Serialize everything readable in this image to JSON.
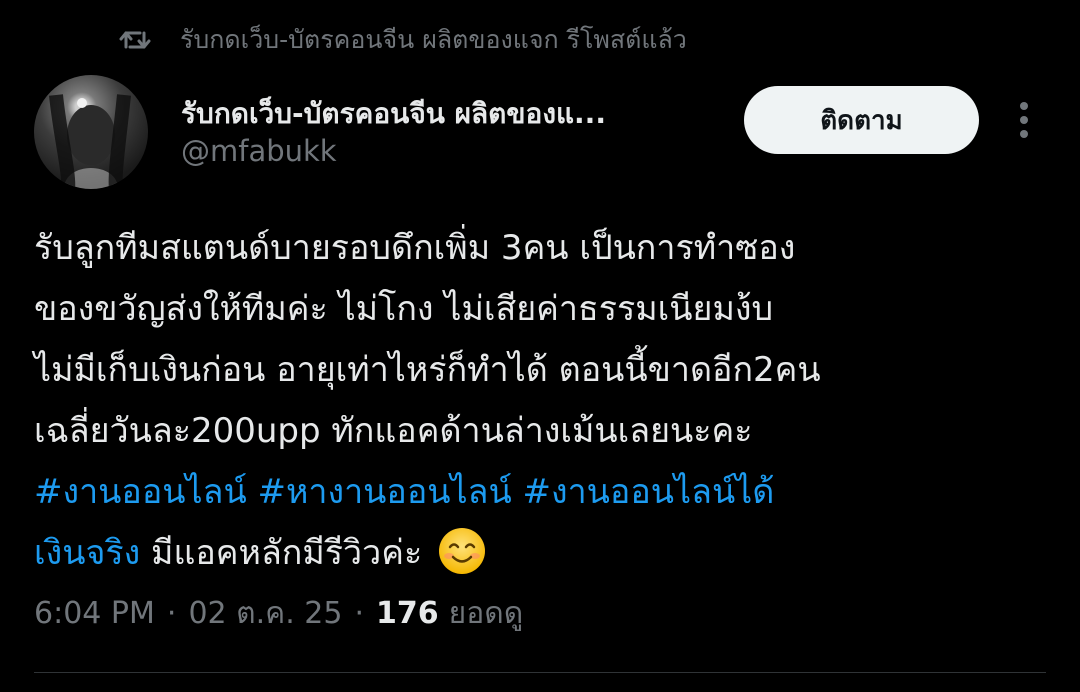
{
  "repost": {
    "text": "รับกดเว็บ-บัตรคอนจีน ผลิตของแจก รีโพสต์แล้ว",
    "icon": "repost-icon"
  },
  "author": {
    "display_name": "รับกดเว็บ-บัตรคอนจีน ผลิตของแ...",
    "handle": "@mfabukk"
  },
  "follow_label": "ติดตาม",
  "tweet": {
    "line1": "รับลูกทีมสแตนด์บายรอบดึกเพิ่ม 3คน เป็นการทำซอง",
    "line2": "ของขวัญส่งให้ทีมค่ะ  ไม่โกง ไม่เสียค่าธรรมเนียมง้บ",
    "line3": "ไม่มีเก็บเงินก่อน อายุเท่าไหร่ก็ทำได้ ตอนนี้ขาดอีก2คน",
    "line4": "เฉลี่ยวันละ200upp ทักแอคด้านล่างเม้นเลยนะคะ",
    "hashtag1": "#งานออนไลน์",
    "hashtag2": "#หางานออนไลน์",
    "hashtag3_part1": "#งานออนไลน์ได้",
    "hashtag3_part2": "เงินจริง",
    "trailing_text": " มีแอคหลักมีรีวิวค่ะ",
    "emoji": "smiling-face-emoji"
  },
  "meta": {
    "time": "6:04 PM",
    "date": "02 ต.ค. 25",
    "views_count": "176",
    "views_label": "ยอดดู"
  },
  "colors": {
    "background": "#000000",
    "text": "#e7e9ea",
    "muted": "#71767b",
    "link": "#1d9bf0",
    "button_bg": "#eff3f4"
  }
}
